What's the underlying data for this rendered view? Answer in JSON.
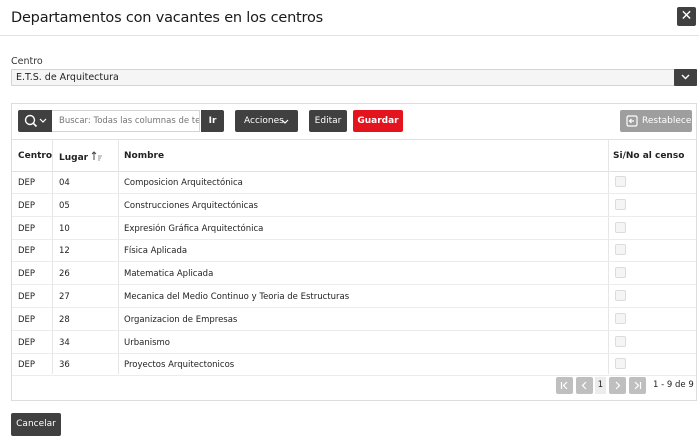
{
  "dialog": {
    "title": "Departamentos con vacantes en los centros",
    "close_symbol": "✕"
  },
  "centro": {
    "label": "Centro",
    "value": "E.T.S. de Arquitectura"
  },
  "toolbar": {
    "search_placeholder": "Buscar: Todas las columnas de texto",
    "go_label": "Ir",
    "actions_label": "Acciones",
    "edit_label": "Editar",
    "save_label": "Guardar",
    "reset_label": "Restablecer"
  },
  "table": {
    "columns": [
      "Centro",
      "Lugar",
      "Nombre",
      "Si/No al censo"
    ],
    "rows": [
      {
        "centro": "DEP",
        "lugar": "04",
        "nombre": "Composicion Arquitectónica"
      },
      {
        "centro": "DEP",
        "lugar": "05",
        "nombre": "Construcciones Arquitectónicas"
      },
      {
        "centro": "DEP",
        "lugar": "10",
        "nombre": "Expresión Gráfica Arquitectónica"
      },
      {
        "centro": "DEP",
        "lugar": "12",
        "nombre": "Física Aplicada"
      },
      {
        "centro": "DEP",
        "lugar": "26",
        "nombre": "Matematica Aplicada"
      },
      {
        "centro": "DEP",
        "lugar": "27",
        "nombre": "Mecanica del Medio Continuo y Teoria de Estructuras"
      },
      {
        "centro": "DEP",
        "lugar": "28",
        "nombre": "Organizacion de Empresas"
      },
      {
        "centro": "DEP",
        "lugar": "34",
        "nombre": "Urbanismo"
      },
      {
        "centro": "DEP",
        "lugar": "36",
        "nombre": "Proyectos Arquitectonicos"
      }
    ]
  },
  "pagination": {
    "current_page": "1",
    "range_label": "1 - 9 de 9"
  },
  "footer": {
    "cancel_label": "Cancelar"
  },
  "colors": {
    "dark_button": "#404040",
    "save_button": "#e3141e",
    "disabled_button": "#9e9e9e"
  },
  "icons": [
    "close-icon",
    "chevron-down-icon",
    "search-icon",
    "sort-ascending-icon",
    "reset-icon",
    "first-page-icon",
    "previous-page-icon",
    "next-page-icon",
    "last-page-icon"
  ]
}
